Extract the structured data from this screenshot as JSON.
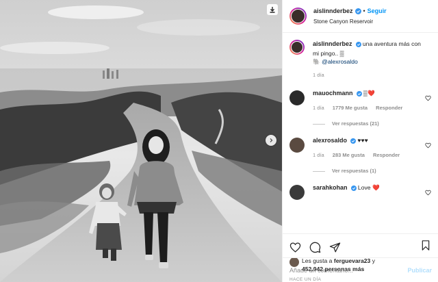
{
  "post": {
    "author": "aislinnderbez",
    "follow_label": "Seguir",
    "separator": "•",
    "location": "Stone Canyon Reservoir"
  },
  "caption": {
    "username": "aislinnderbez",
    "text": "una aventura más con mi pingo.. ▒",
    "mention_prefix": "🐘",
    "mention": "@alexrosaldo",
    "time": "1 día"
  },
  "comments": [
    {
      "username": "mauochmann",
      "text": "▒❤️",
      "time": "1 día",
      "likes": "1779 Me gusta",
      "reply_label": "Responder",
      "view_replies": "Ver respuestas (21)"
    },
    {
      "username": "alexrosaldo",
      "text": "♥♥♥",
      "time": "1 día",
      "likes": "283 Me gusta",
      "reply_label": "Responder",
      "view_replies": "Ver respuestas (1)"
    },
    {
      "username": "sarahkohan",
      "text": "Love ❤️"
    }
  ],
  "likes": {
    "prefix": "Les gusta a ",
    "user": "ferguevara23",
    "mid": " y",
    "count": "452.942 personas más"
  },
  "timestamp": "HACE UN DÍA",
  "add_comment": {
    "placeholder": "Añade un comentario...",
    "publish_label": "Publicar"
  },
  "colors": {
    "accent": "#0095f6",
    "verified": "#3897f0",
    "heart": "#ed4956",
    "muted": "#8e8e8e"
  },
  "icons": [
    "save-image-icon",
    "next-arrow-icon",
    "verified-icon",
    "heart-icon",
    "comment-icon",
    "share-icon",
    "bookmark-icon"
  ]
}
